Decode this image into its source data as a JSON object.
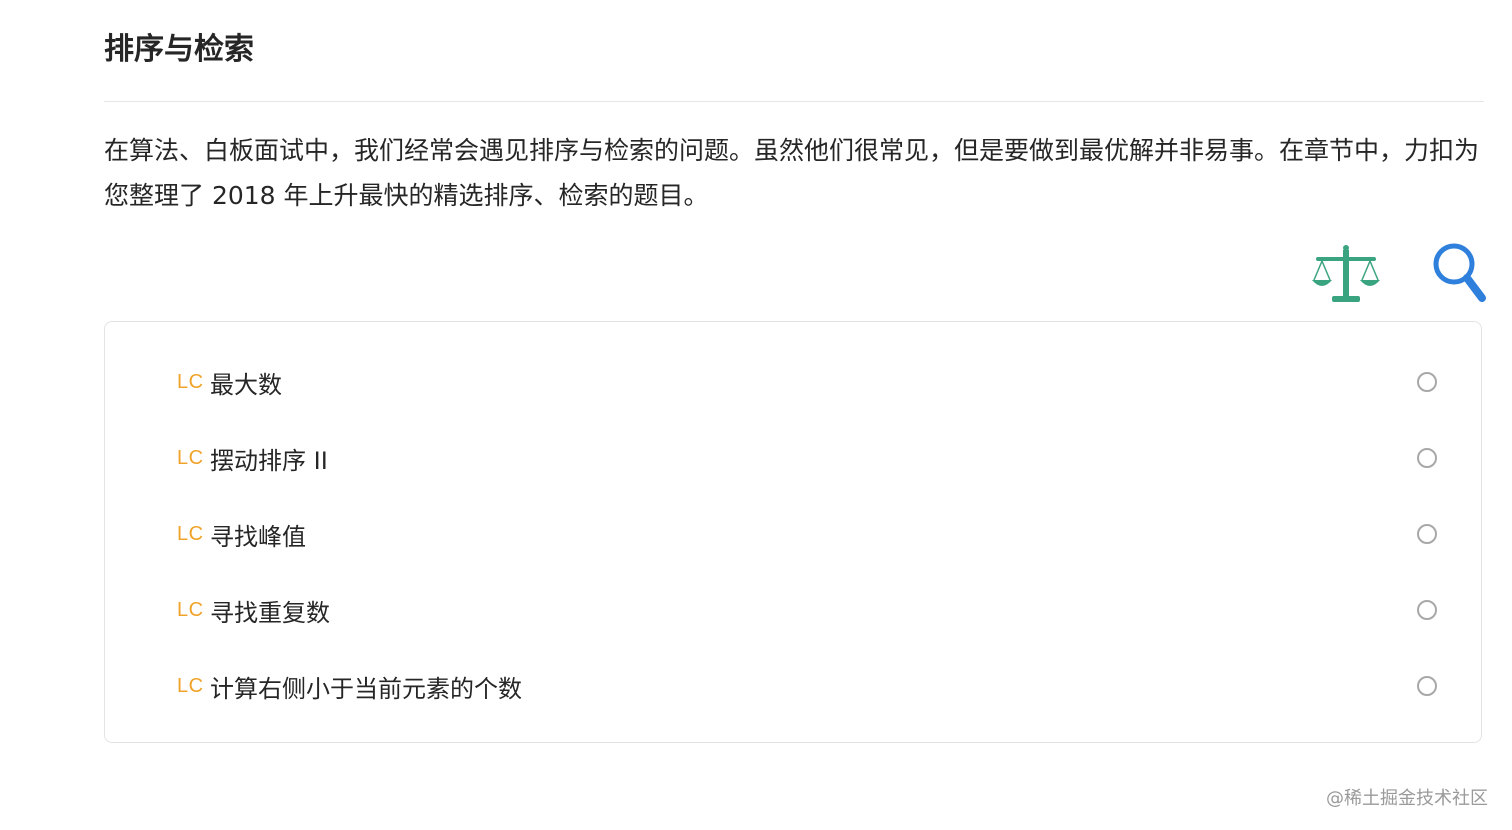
{
  "section": {
    "title": "排序与检索",
    "description": "在算法、白板面试中，我们经常会遇见排序与检索的问题。虽然他们很常见，但是要做到最优解并非易事。在章节中，力扣为您整理了 2018 年上升最快的精选排序、检索的题目。"
  },
  "icons": {
    "scale": "scale-balance-icon",
    "search": "magnifier-icon",
    "scale_color": "#3aa380",
    "search_color": "#2f7fdc"
  },
  "problems": [
    {
      "badge": "LC",
      "title": "最大数",
      "completed": false
    },
    {
      "badge": "LC",
      "title": "摆动排序 II",
      "completed": false
    },
    {
      "badge": "LC",
      "title": "寻找峰值",
      "completed": false
    },
    {
      "badge": "LC",
      "title": "寻找重复数",
      "completed": false
    },
    {
      "badge": "LC",
      "title": "计算右侧小于当前元素的个数",
      "completed": false
    }
  ],
  "watermark": "@稀土掘金技术社区",
  "colors": {
    "badge": "#f0a32a",
    "text": "#262626",
    "border": "#e3e3e3"
  }
}
